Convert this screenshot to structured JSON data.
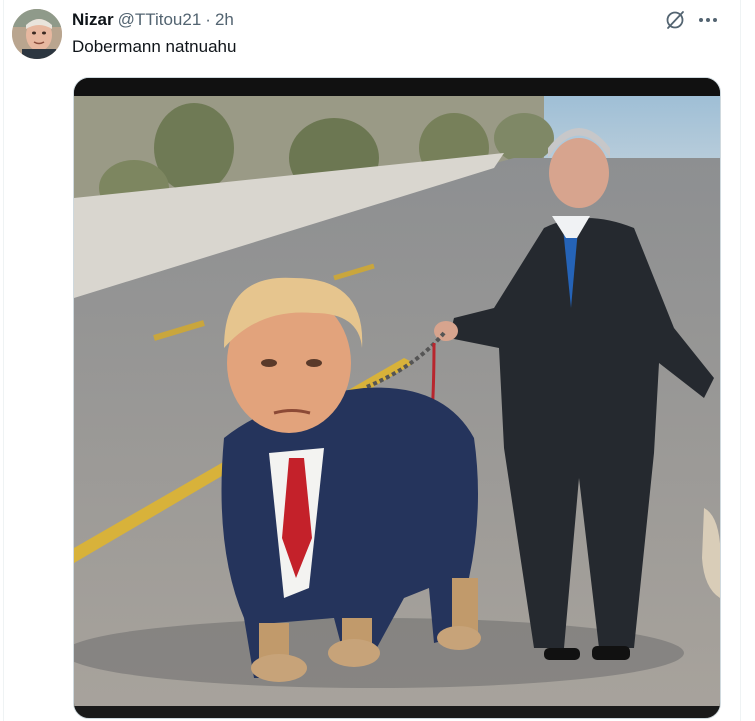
{
  "tweet": {
    "author_name": "Nizar",
    "handle": "@TTitou21",
    "separator": "·",
    "time": "2h",
    "text": "Dobermann natnuahu"
  },
  "icons": {
    "grok": "grok-icon",
    "more": "more-icon"
  },
  "colors": {
    "text_primary": "#0f1419",
    "text_secondary": "#536471",
    "border": "#cfd9de"
  }
}
